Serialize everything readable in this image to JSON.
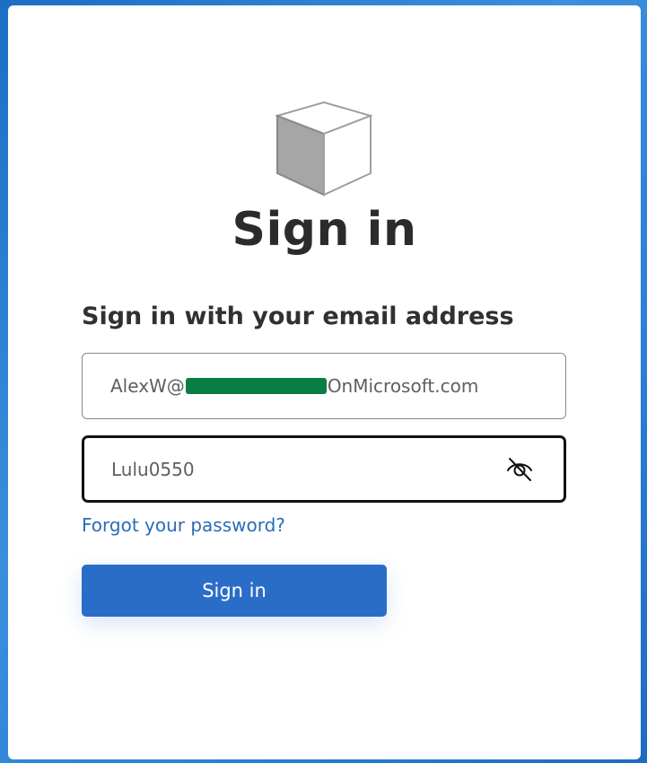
{
  "title": "Sign in",
  "subtitle": "Sign in with your email address",
  "email": {
    "prefix": "AlexW@",
    "suffix": "OnMicrosoft.com"
  },
  "password": {
    "value": "Lulu0550",
    "visibility_icon": "eye-slash-icon"
  },
  "forgot_link": "Forgot your password?",
  "signin_button": "Sign in",
  "colors": {
    "primary": "#2a6dc9",
    "link": "#2b6cb8",
    "redaction": "#0a7d47",
    "background": "#1a6fc4"
  }
}
